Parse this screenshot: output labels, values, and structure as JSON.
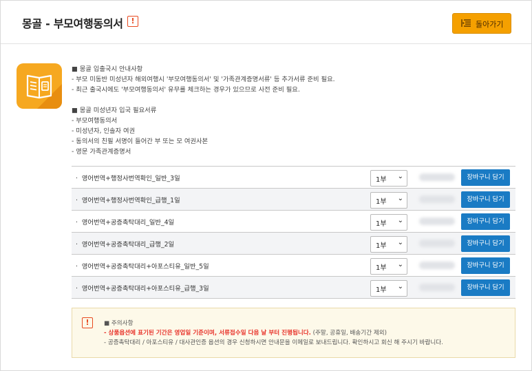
{
  "header": {
    "title": "몽골 - 부모여행동의서",
    "alert_icon": "exclamation-icon",
    "back_button_label": "돌아가기",
    "back_button_icon": "list-back-icon",
    "accent_color": "#f5a000"
  },
  "info": {
    "section1_heading": "■ 몽골 입출국시 안내사항",
    "section1_lines": [
      "- 부모 미동반 미성년자 해외여행시 '부모여행동의서' 및 '가족관계증명서류' 등 추가서류 준비 필요.",
      "- 최근 출국시에도 '부모여행동의서' 유무를 체크하는 경우가 있으므로 사전 준비 필요."
    ],
    "section2_heading": "■ 몽골 미성년자 입국 필요서류",
    "section2_lines": [
      "- 부모여행동의서",
      "- 미성년자, 인솔자 여권",
      "- 동의서의 친필 서명이 들어간 부 또는 모 여권사본",
      "- 영문 가족관계증명서"
    ]
  },
  "options": [
    {
      "name": "영어번역+행정사번역확인_일반_3일",
      "qty": "1부",
      "cart_label": "장바구니 담기"
    },
    {
      "name": "영어번역+행정사번역확인_급행_1일",
      "qty": "1부",
      "cart_label": "장바구니 담기"
    },
    {
      "name": "영어번역+공증촉탁대리_일반_4일",
      "qty": "1부",
      "cart_label": "장바구니 담기"
    },
    {
      "name": "영어번역+공증촉탁대리_급행_2일",
      "qty": "1부",
      "cart_label": "장바구니 담기"
    },
    {
      "name": "영어번역+공증촉탁대리+아포스티유_일반_5일",
      "qty": "1부",
      "cart_label": "장바구니 담기"
    },
    {
      "name": "영어번역+공증촉탁대리+아포스티유_급행_3일",
      "qty": "1부",
      "cart_label": "장바구니 담기"
    }
  ],
  "notice": {
    "heading": "■ 주의사항",
    "line1_emphasis": "- 상품옵션에 표기된 기간은 영업일 기준이며, 서류접수일 다음 날 부터 진행됩니다.",
    "line1_rest": " (주말, 공휴일, 배송기간 제외)",
    "line2": "- 공증촉탁대리 / 아포스티유 / 대사관인증 옵션의 경우 신청하시면 안내문을 이메일로 보내드립니다. 확인하시고 회신 해 주시기 바랍니다."
  },
  "colors": {
    "cart_button": "#1a7bc4",
    "notice_background": "#fdf9e9",
    "warning_red": "#e8332a"
  }
}
